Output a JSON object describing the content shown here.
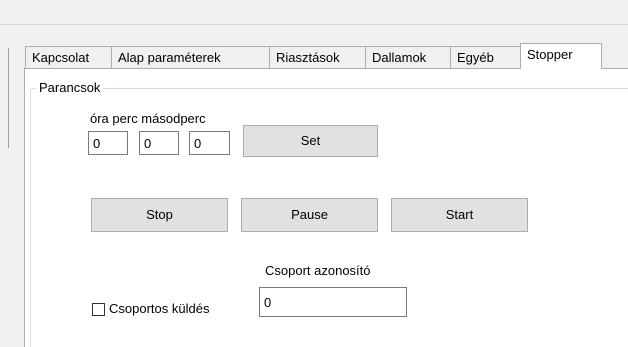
{
  "tabs": [
    {
      "label": "Kapcsolat",
      "active": false
    },
    {
      "label": "Alap paraméterek",
      "active": false
    },
    {
      "label": "Riasztások",
      "active": false
    },
    {
      "label": "Dallamok",
      "active": false
    },
    {
      "label": "Egyéb",
      "active": false
    },
    {
      "label": "Stopper",
      "active": true
    }
  ],
  "commands": {
    "group_title": "Parancsok",
    "time_header": "óra perc másodperc",
    "hours_value": "0",
    "minutes_value": "0",
    "seconds_value": "0",
    "set_label": "Set",
    "stop_label": "Stop",
    "pause_label": "Pause",
    "start_label": "Start",
    "group_id_label": "Csoport azonosító",
    "group_id_value": "0",
    "group_send_label": "Csoportos küldés",
    "group_send_checked": false
  }
}
